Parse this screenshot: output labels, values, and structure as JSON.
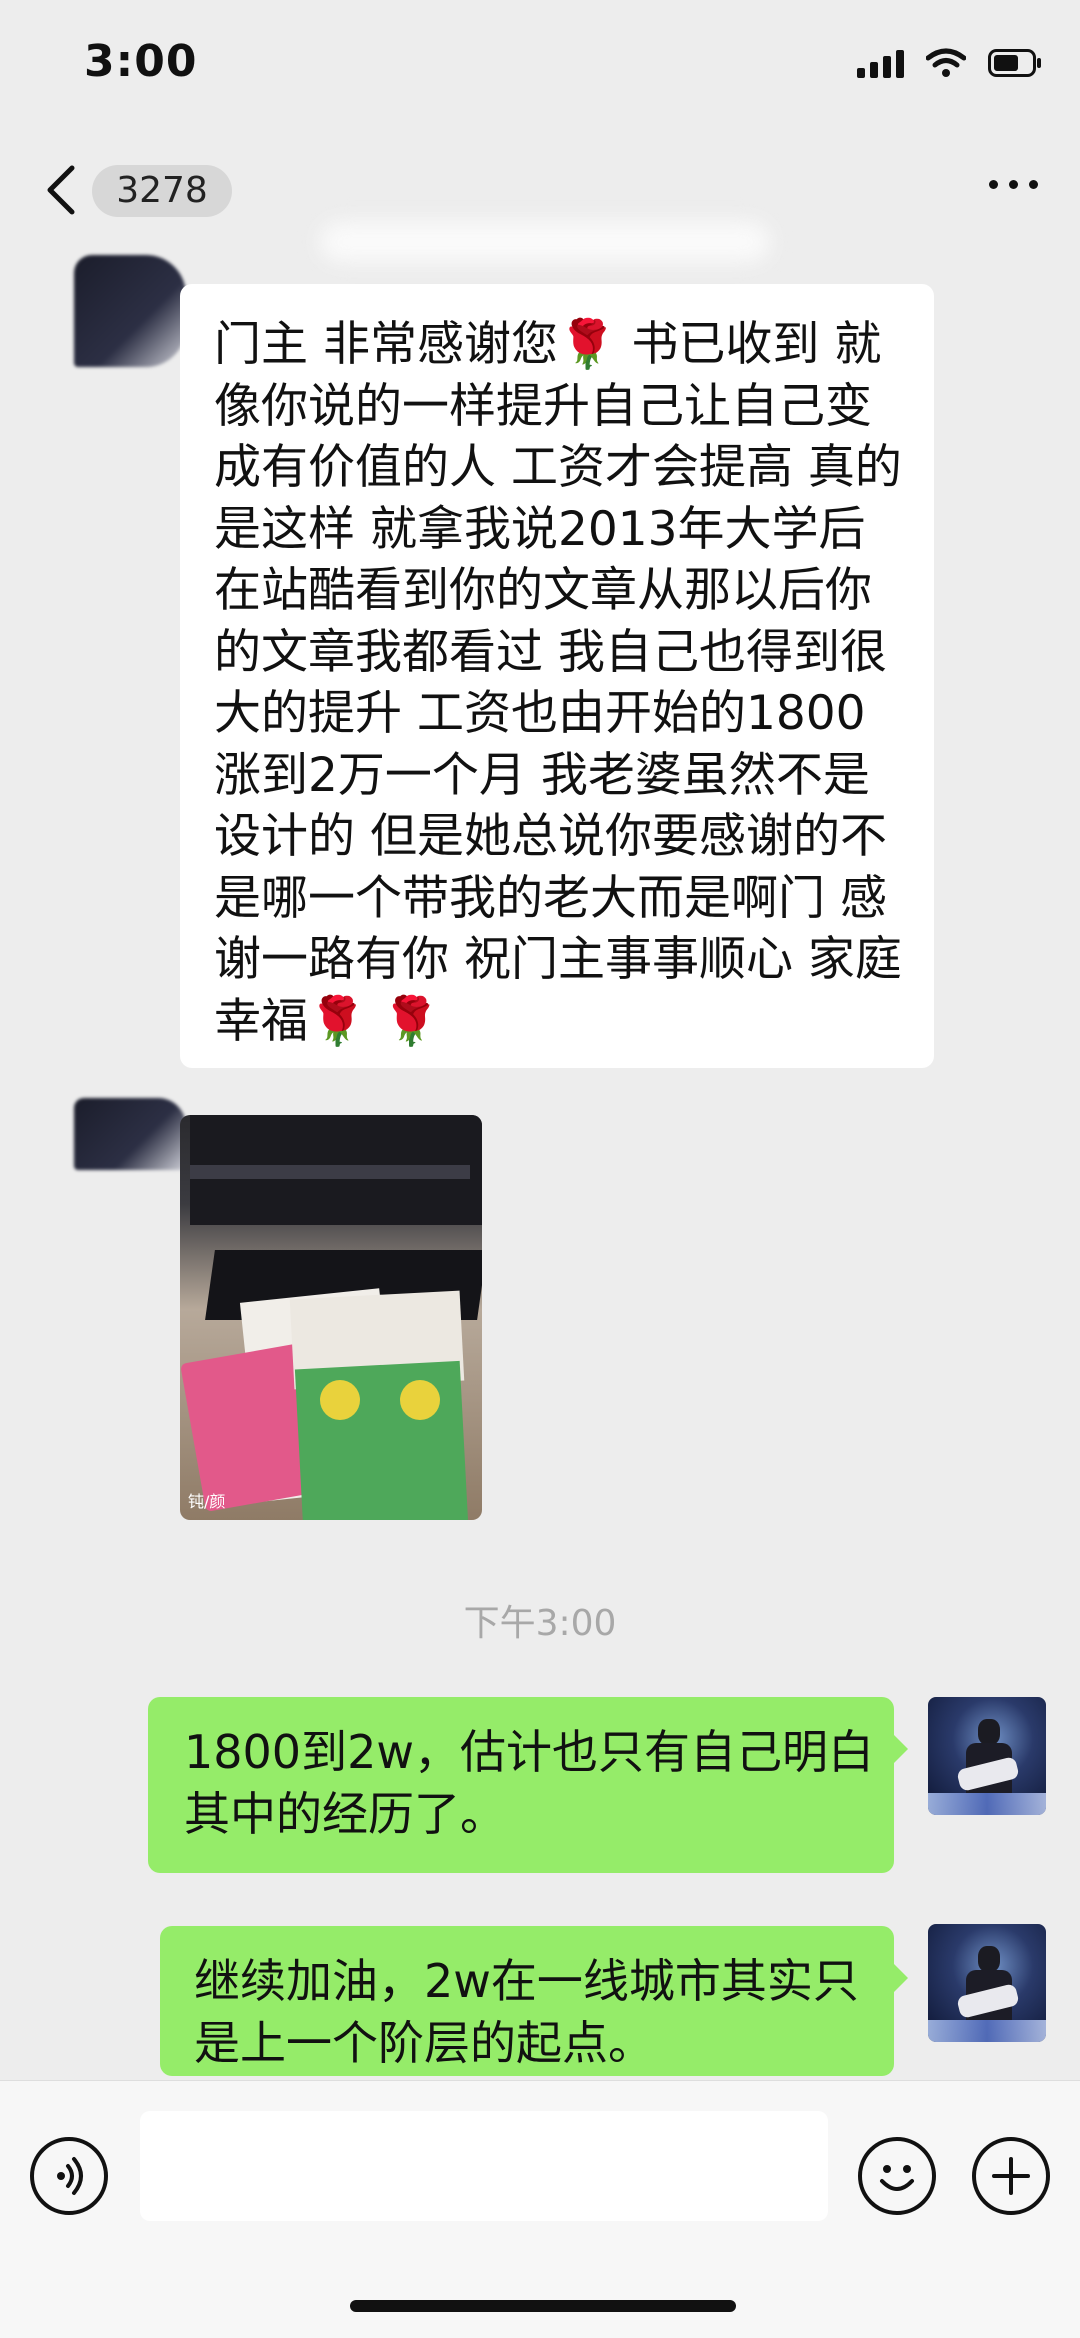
{
  "status_bar": {
    "time": "3:00",
    "icons": [
      "signal-icon",
      "wifi-icon",
      "battery-icon"
    ]
  },
  "nav": {
    "back_icon": "chevron-left-icon",
    "unread_count": "3278",
    "more_icon": "more-icon"
  },
  "messages": [
    {
      "type": "text",
      "side": "left",
      "text": "门主 非常感谢您🌹 书已收到 就像你说的一样提升自己让自己变成有价值的人 工资才会提高 真的是这样 就拿我说2013年大学后 在站酷看到你的文章从那以后你的文章我都看过 我自己也得到很大的提升 工资也由开始的1800涨到2万一个月 我老婆虽然不是设计的 但是她总说你要感谢的不是哪一个带我的老大而是啊门 感谢一路有你 祝门主事事顺心 家庭幸福🌹 🌹"
    },
    {
      "type": "image",
      "side": "left",
      "description": "photo-of-books-on-desk",
      "watermark": "钝/颜"
    },
    {
      "type": "timestamp",
      "text": "下午3:00"
    },
    {
      "type": "text",
      "side": "right",
      "text": "1800到2w，估计也只有自己明白其中的经历了。"
    },
    {
      "type": "text",
      "side": "right",
      "text": "继续加油，2w在一线城市其实只是上一个阶层的起点。"
    }
  ],
  "input_bar": {
    "voice_icon": "voice-icon",
    "input_value": "",
    "emoji_icon": "emoji-icon",
    "plus_icon": "plus-icon"
  },
  "colors": {
    "background": "#ededed",
    "sent_bubble": "#95ec69",
    "received_bubble": "#ffffff",
    "timestamp_text": "#a8a8a8"
  }
}
